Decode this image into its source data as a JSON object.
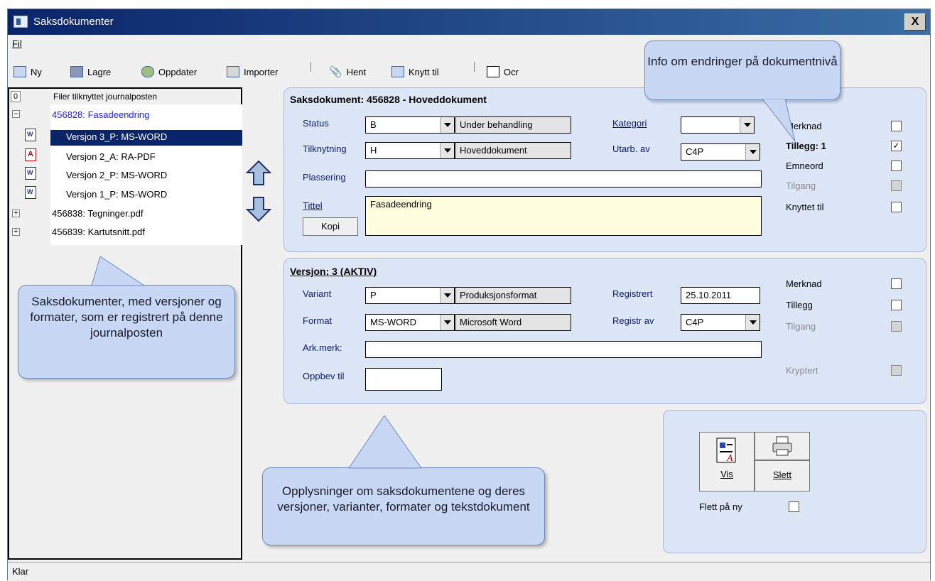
{
  "window": {
    "title": "Saksdokumenter",
    "close_label": "X"
  },
  "menu": {
    "file": "Fil"
  },
  "toolbar": {
    "new": "Ny",
    "save": "Lagre",
    "update": "Oppdater",
    "import": "Importer",
    "fetch": "Hent",
    "link": "Knytt til",
    "ocr": "Ocr"
  },
  "tree": {
    "header_num": "0",
    "header": "Filer tilknyttet journalposten",
    "root": "456828: Fasadeendring",
    "versions": [
      "Versjon 3_P: MS-WORD",
      "Versjon 2_A: RA-PDF",
      "Versjon 2_P: MS-WORD",
      "Versjon 1_P: MS-WORD"
    ],
    "others": [
      "456838: Tegninger.pdf",
      "456839: Kartutsnitt.pdf"
    ]
  },
  "doc": {
    "title": "Saksdokument: 456828 - Hoveddokument",
    "status_label": "Status",
    "status_code": "B",
    "status_text": "Under behandling",
    "category_label": "Kategori",
    "category_value": "",
    "link_label": "Tilknytning",
    "link_code": "H",
    "link_text": "Hoveddokument",
    "author_label": "Utarb. av",
    "author_value": "C4P",
    "place_label": "Plassering",
    "place_value": "",
    "title_label": "Tittel",
    "title_value": "Fasadeendring",
    "copy_button": "Kopi",
    "checks": [
      {
        "label": "Merknad",
        "checked": false,
        "disabled": false,
        "bold": false
      },
      {
        "label": "Tillegg: 1",
        "checked": true,
        "disabled": false,
        "bold": true
      },
      {
        "label": "Emneord",
        "checked": false,
        "disabled": false,
        "bold": false
      },
      {
        "label": "Tilgang",
        "checked": false,
        "disabled": true,
        "bold": false
      },
      {
        "label": "Knyttet til",
        "checked": false,
        "disabled": false,
        "bold": false
      }
    ]
  },
  "version": {
    "title": "Versjon: 3 (AKTIV)",
    "variant_label": "Variant",
    "variant_code": "P",
    "variant_text": "Produksjonsformat",
    "reg_label": "Registrert",
    "reg_value": "25.10.2011",
    "format_label": "Format",
    "format_code": "MS-WORD",
    "format_text": "Microsoft Word",
    "regby_label": "Registr av",
    "regby_value": "C4P",
    "ark_label": "Ark.merk:",
    "ark_value": "",
    "keep_label": "Oppbev til",
    "keep_value": "",
    "checks": [
      {
        "label": "Merknad",
        "disabled": false
      },
      {
        "label": "Tillegg",
        "disabled": false
      },
      {
        "label": "Tilgang",
        "disabled": true
      },
      {
        "label": "Kryptert",
        "disabled": true
      }
    ]
  },
  "actions": {
    "view": "Vis",
    "delete": "Slett",
    "merge_label": "Flett på ny"
  },
  "callouts": {
    "top": "Info om endringer på dokumentnivå",
    "left": "Saksdokumenter, med versjoner og formater, som er registrert på denne journalposten",
    "bottom": "Opplysninger om saksdokumentene og deres versjoner, varianter, formater og tekstdokument"
  },
  "status": {
    "text": "Klar"
  }
}
